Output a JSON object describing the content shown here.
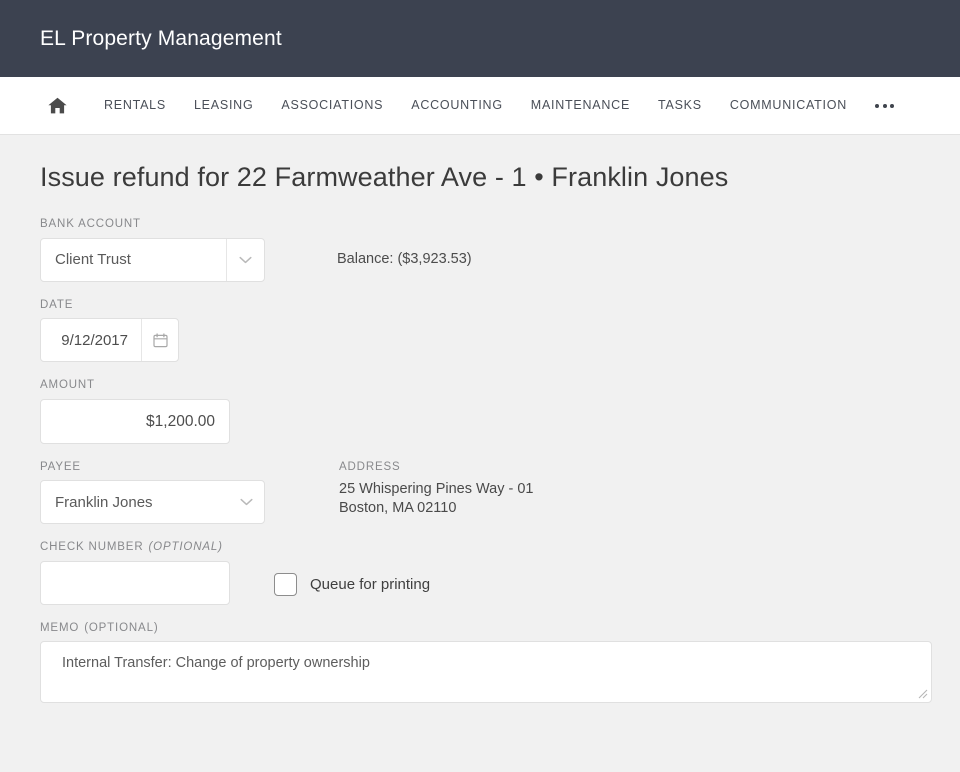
{
  "brand": {
    "title": "EL Property Management"
  },
  "nav": {
    "home_icon": "home-icon",
    "items": [
      {
        "label": "RENTALS"
      },
      {
        "label": "LEASING"
      },
      {
        "label": "ASSOCIATIONS"
      },
      {
        "label": "ACCOUNTING"
      },
      {
        "label": "MAINTENANCE"
      },
      {
        "label": "TASKS"
      },
      {
        "label": "COMMUNICATION"
      }
    ],
    "overflow_icon": "ellipsis-icon"
  },
  "page": {
    "title": "Issue refund for 22 Farmweather Ave - 1 • Franklin Jones"
  },
  "form": {
    "bank_account": {
      "label": "BANK ACCOUNT",
      "value": "Client Trust",
      "chevron_icon": "chevron-down-icon",
      "balance_text": "Balance: ($3,923.53)"
    },
    "date": {
      "label": "DATE",
      "value": "9/12/2017",
      "calendar_icon": "calendar-icon"
    },
    "amount": {
      "label": "AMOUNT",
      "value": "$1,200.00"
    },
    "payee": {
      "label": "PAYEE",
      "value": "Franklin Jones",
      "chevron_icon": "chevron-down-icon"
    },
    "address": {
      "label": "ADDRESS",
      "lines": "25 Whispering Pines Way - 01\nBoston, MA 02110"
    },
    "check_number": {
      "label": "CHECK NUMBER",
      "optional_tag": "(OPTIONAL)",
      "value": "",
      "placeholder": ""
    },
    "queue_for_printing": {
      "label": "Queue for printing",
      "checked": false
    },
    "memo": {
      "label": "MEMO",
      "optional_tag": "(OPTIONAL)",
      "value": "Internal Transfer: Change of property ownership"
    }
  },
  "colors": {
    "brand_bar": "#3c4250",
    "page_background": "#f1f1f1",
    "nav_background": "#ffffff",
    "label_text": "#88898c",
    "body_text": "#4a4a4a"
  }
}
